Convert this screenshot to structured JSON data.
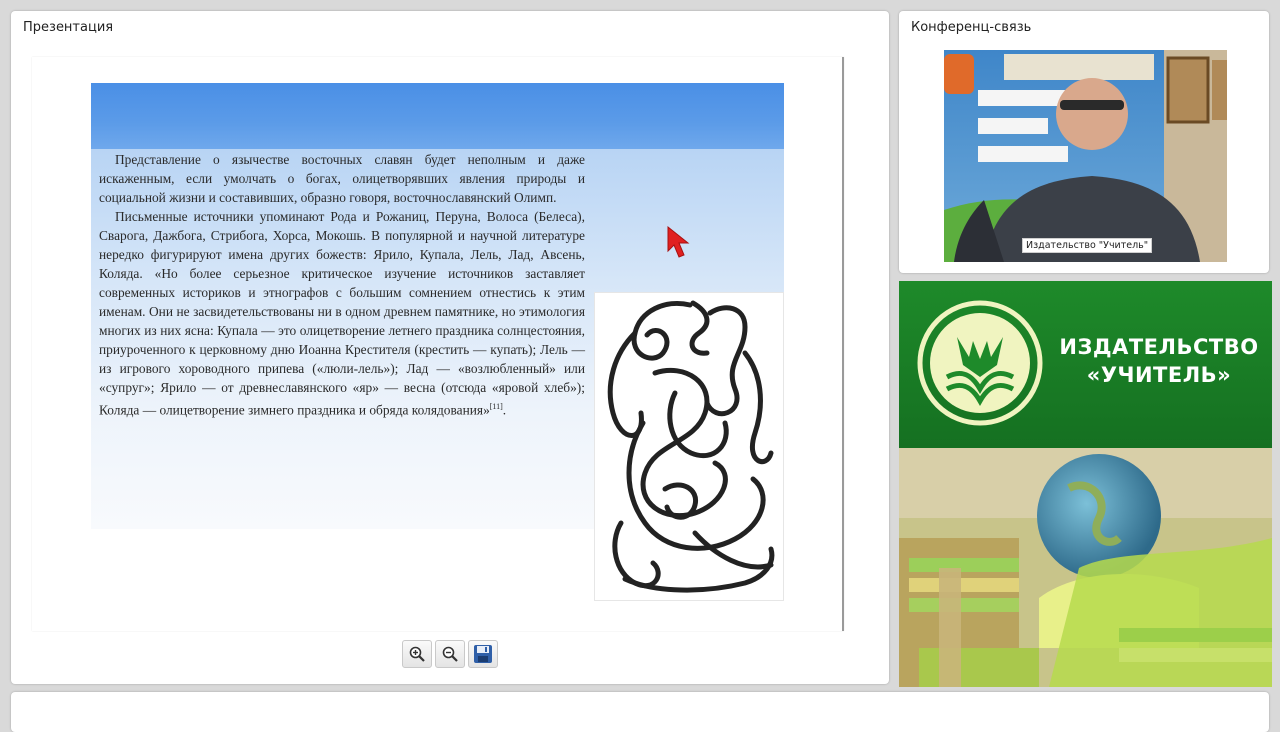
{
  "presentation": {
    "title": "Презентация",
    "paragraphs": [
      "Представление о язычестве восточных славян будет неполным и даже искаженным, если умолчать о богах, олицетворявших явления природы и социальной жизни и составивших, образно говоря, восточнославянский Олимп.",
      "Письменные источники упоминают Рода и Рожаниц, Перуна, Волоса (Белеса), Сварога, Дажбога, Стрибога, Хорса, Мокошь. В популярной и научной литературе нередко фигурируют имена других божеств: Ярило, Купала, Лель, Лад, Авсень, Коляда. «Но более серьезное критическое изучение источников заставляет современных историков и этнографов с большим сомнением отнестись к этим именам. Они не засвидетельствованы ни в одном древнем памятнике, но этимология многих из них ясна: Купала — это олицетворение летнего праздника солнцестояния, приуроченного к церковному дню Иоанна Крестителя (крестить — купать); Лель — из игрового хороводного припева («люли-лель»); Лад — «возлюбленный» или «супруг»; Ярило — от древнеславянского «яр» — весна (отсюда «яровой хлеб»); Коляда — олицетворение зимнего праздника и обряда колядования»"
    ],
    "footnote": "[11]",
    "footnote_tail": ".",
    "toolbar": {
      "zoom_in_icon": "zoom-in-icon",
      "zoom_out_icon": "zoom-out-icon",
      "save_icon": "save-icon"
    }
  },
  "conference": {
    "title": "Конференц-связь",
    "speaker_caption": "Издательство \"Учитель\""
  },
  "banner": {
    "line1": "ИЗДАТЕЛЬСТВО",
    "line2": "«УЧИТЕЛЬ»"
  },
  "colors": {
    "slide_header": "#4a8fe6",
    "banner_green": "#1e8a2a",
    "cursor_red": "#e02020"
  }
}
